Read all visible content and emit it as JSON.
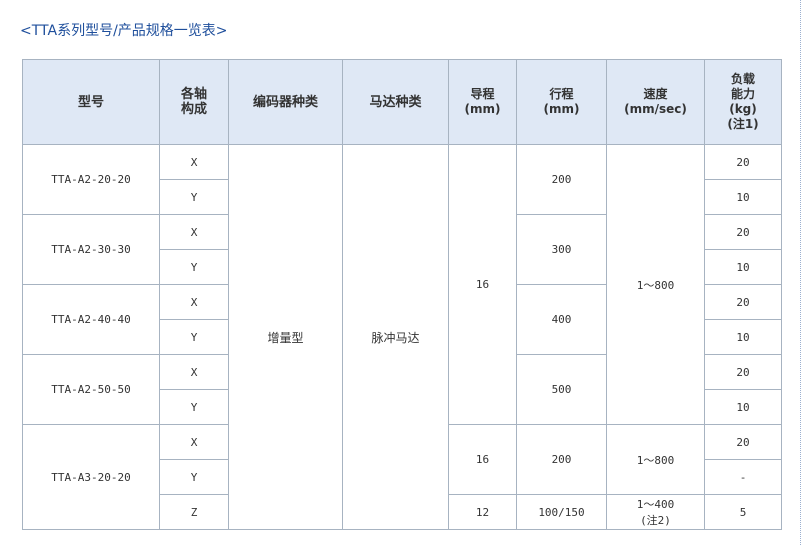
{
  "page": {
    "title": "<TTA系列型号/产品规格一览表>"
  },
  "table": {
    "headers": {
      "model": "型号",
      "axis": "各轴\n构成",
      "encoder": "编码器种类",
      "motor": "马达种类",
      "lead": "导程\n(mm)",
      "stroke": "行程\n(mm)",
      "speed": "速度\n(mm/sec)",
      "payload": "负载\n能力\n(kg)\n(注1)"
    },
    "groups": [
      {
        "model": "TTA-A2-20-20",
        "stroke": "200",
        "rows": [
          {
            "axis": "X",
            "payload": "20"
          },
          {
            "axis": "Y",
            "payload": "10"
          }
        ]
      },
      {
        "model": "TTA-A2-30-30",
        "stroke": "300",
        "rows": [
          {
            "axis": "X",
            "payload": "20"
          },
          {
            "axis": "Y",
            "payload": "10"
          }
        ]
      },
      {
        "model": "TTA-A2-40-40",
        "stroke": "400",
        "rows": [
          {
            "axis": "X",
            "payload": "20"
          },
          {
            "axis": "Y",
            "payload": "10"
          }
        ]
      },
      {
        "model": "TTA-A2-50-50",
        "stroke": "500",
        "rows": [
          {
            "axis": "X",
            "payload": "20"
          },
          {
            "axis": "Y",
            "payload": "10"
          }
        ]
      }
    ],
    "a2_lead": "16",
    "a2_speed": "1～800",
    "encoder": "增量型",
    "motor": "脉冲马达",
    "a3": {
      "model": "TTA-A3-20-20",
      "xy": {
        "lead": "16",
        "stroke": "200",
        "speed": "1～800"
      },
      "rows": [
        {
          "axis": "X",
          "payload": "20"
        },
        {
          "axis": "Y",
          "payload": "-"
        },
        {
          "axis": "Z",
          "payload": "5"
        }
      ],
      "z": {
        "lead": "12",
        "stroke": "100/150",
        "speed": "1～400\n(注2)"
      }
    }
  }
}
